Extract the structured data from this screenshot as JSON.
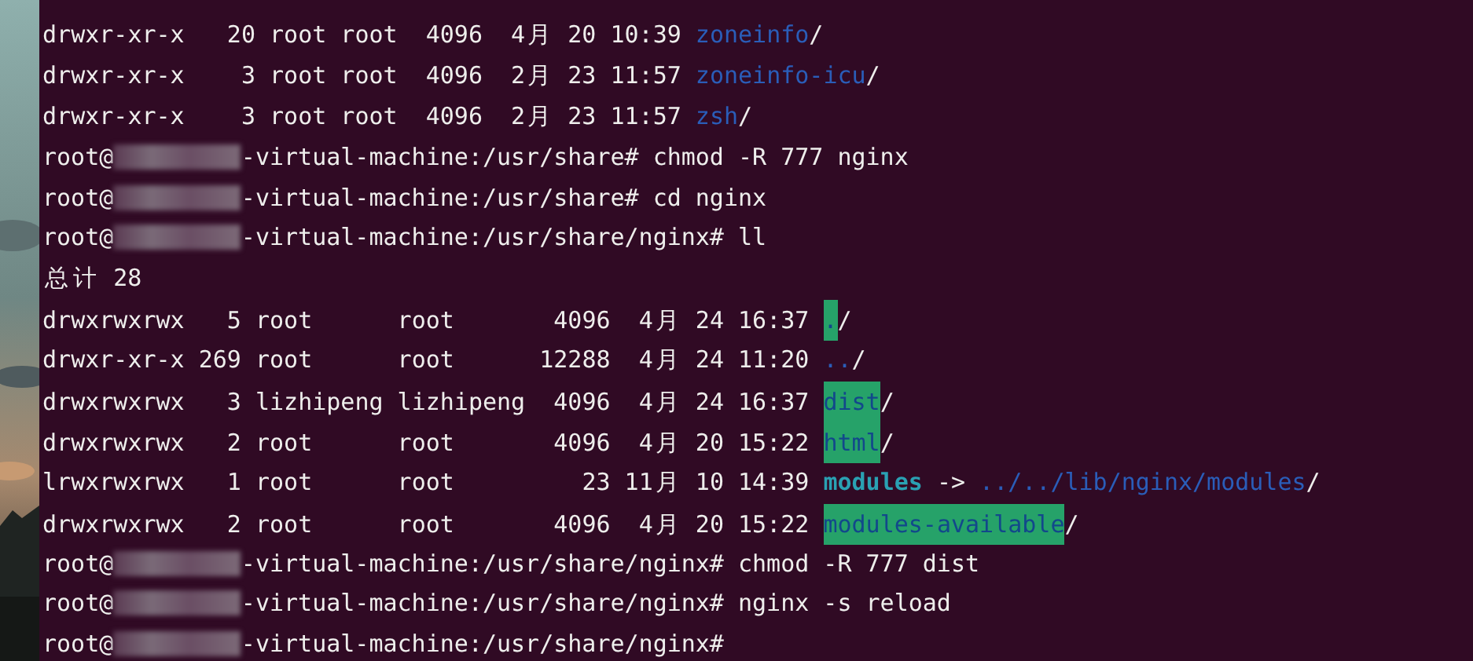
{
  "terminal": {
    "lines": [
      {
        "kind": "dir_entry",
        "info": "drwxr-xr-x   20 root root  4096  4月 20 10:39 ",
        "name": "zoneinfo",
        "suffix": "/"
      },
      {
        "kind": "dir_entry",
        "info": "drwxr-xr-x    3 root root  4096  2月 23 11:57 ",
        "name": "zoneinfo-icu",
        "suffix": "/"
      },
      {
        "kind": "dir_entry",
        "info": "drwxr-xr-x    3 root root  4096  2月 23 11:57 ",
        "name": "zsh",
        "suffix": "/"
      },
      {
        "kind": "prompt",
        "before_mask": "root@",
        "redacted": true,
        "after_mask": "-virtual-machine:/usr/share# chmod -R 777 nginx"
      },
      {
        "kind": "prompt",
        "before_mask": "root@",
        "redacted": true,
        "after_mask": "-virtual-machine:/usr/share# cd nginx"
      },
      {
        "kind": "prompt",
        "before_mask": "root@",
        "redacted": true,
        "after_mask": "-virtual-machine:/usr/share/nginx# ll"
      },
      {
        "kind": "output",
        "text": "总计 28"
      },
      {
        "kind": "writable_dir_entry",
        "info": "drwxrwxrwx   5 root      root       4096  4月 24 16:37 ",
        "name": ".",
        "suffix": "/"
      },
      {
        "kind": "dir_entry",
        "info": "drwxr-xr-x 269 root      root      12288  4月 24 11:20 ",
        "name": "..",
        "suffix": "/"
      },
      {
        "kind": "writable_dir_entry",
        "info": "drwxrwxrwx   3 lizhipeng lizhipeng  4096  4月 24 16:37 ",
        "name": "dist",
        "suffix": "/"
      },
      {
        "kind": "writable_dir_entry",
        "info": "drwxrwxrwx   2 root      root       4096  4月 20 15:22 ",
        "name": "html",
        "suffix": "/"
      },
      {
        "kind": "link_entry",
        "info": "lrwxrwxrwx   1 root      root         23 11月 10 14:39 ",
        "name": "modules",
        "arrow": " -> ",
        "target": "../../lib/nginx/modules",
        "suffix": "/"
      },
      {
        "kind": "writable_dir_entry",
        "info": "drwxrwxrwx   2 root      root       4096  4月 20 15:22 ",
        "name": "modules-available",
        "suffix": "/"
      },
      {
        "kind": "prompt",
        "before_mask": "root@",
        "redacted": true,
        "after_mask": "-virtual-machine:/usr/share/nginx# chmod -R 777 dist"
      },
      {
        "kind": "prompt",
        "before_mask": "root@",
        "redacted": true,
        "after_mask": "-virtual-machine:/usr/share/nginx# nginx -s reload"
      },
      {
        "kind": "prompt",
        "before_mask": "root@",
        "redacted": true,
        "after_mask": "-virtual-machine:/usr/share/nginx#"
      }
    ]
  }
}
